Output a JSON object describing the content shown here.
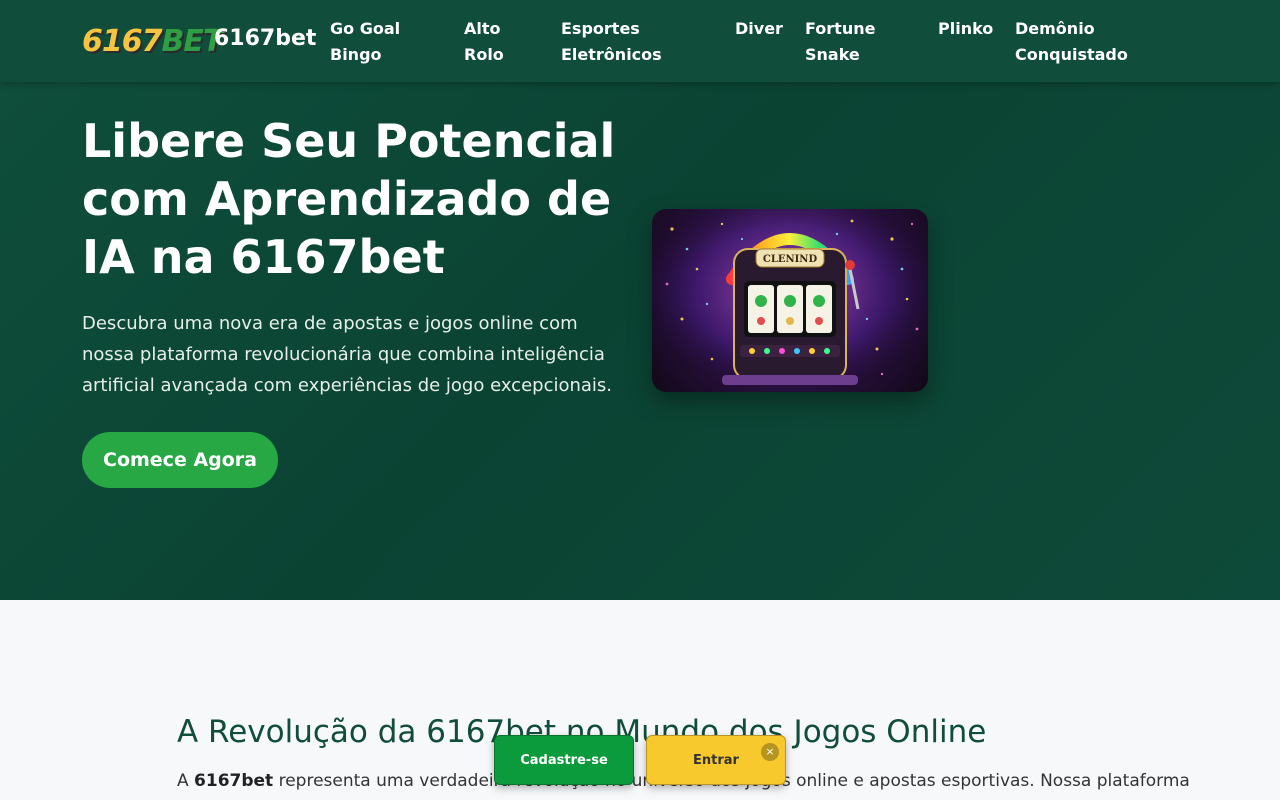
{
  "header": {
    "logo_text_num": "6167",
    "logo_text_bet": "BET",
    "brand": "6167bet",
    "nav": [
      {
        "line1": "Go Goal",
        "line2": "Bingo"
      },
      {
        "line1": "Alto",
        "line2": "Rolo"
      },
      {
        "line1": "Esportes",
        "line2": "Eletrônicos"
      },
      {
        "line1": "Diver",
        "line2": ""
      },
      {
        "line1": "Fortune",
        "line2": "Snake"
      },
      {
        "line1": "Plinko",
        "line2": ""
      },
      {
        "line1": "Demônio",
        "line2": "Conquistado"
      }
    ]
  },
  "hero": {
    "title": "Libere Seu Potencial com Aprendizado de IA na 6167bet",
    "description": "Descubra uma nova era de apostas e jogos online com nossa plataforma revolucionária que combina inteligência artificial avançada com experiências de jogo excepcionais.",
    "cta": "Comece Agora",
    "slot_label": "CLENIND"
  },
  "section": {
    "title": "A Revolução da 6167bet no Mundo dos Jogos Online",
    "text_prefix": "A ",
    "text_bold": "6167bet",
    "text_rest": " representa uma verdadeira revolução no universo dos jogos online e apostas esportivas. Nossa plataforma"
  },
  "sticky": {
    "signup": "Cadastre-se",
    "login": "Entrar",
    "close": "×"
  },
  "colors": {
    "header_bg": "#114d3b",
    "hero_bg": "#0b4333",
    "cta_green": "#28a745",
    "signup_green": "#0c9b3c",
    "login_yellow": "#f7c92d"
  }
}
